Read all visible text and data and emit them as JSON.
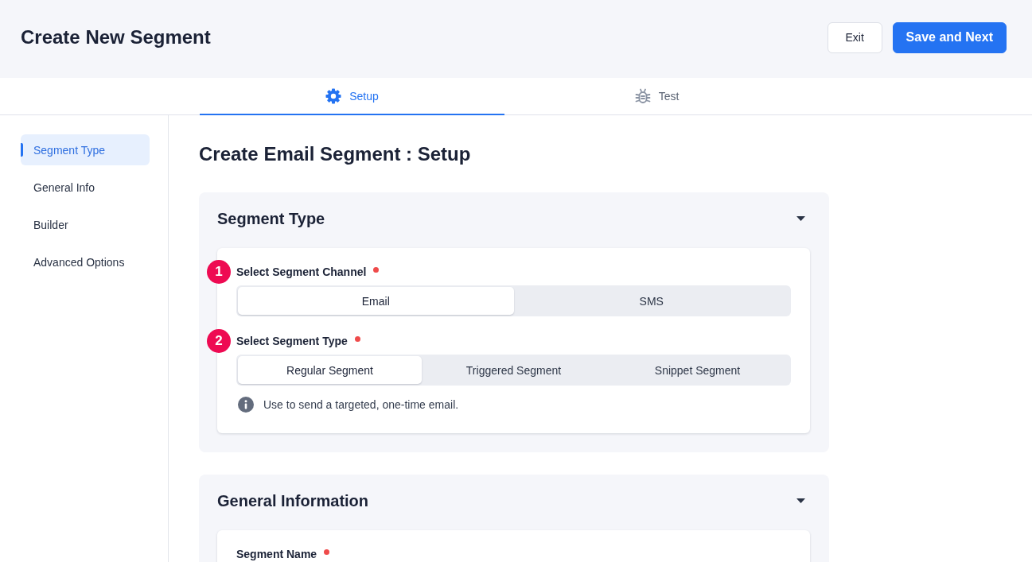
{
  "header": {
    "title": "Create New Segment",
    "buttons": [
      {
        "label": "Exit",
        "kind": "secondary"
      },
      {
        "label": "Save and Next",
        "kind": "primary"
      }
    ]
  },
  "tabs": [
    {
      "label": "Setup",
      "selected": true
    },
    {
      "label": "Test",
      "selected": false
    }
  ],
  "sidebar": {
    "items": [
      {
        "label": "Segment Type",
        "selected": true
      },
      {
        "label": "General Info",
        "selected": false
      },
      {
        "label": "Builder",
        "selected": false
      },
      {
        "label": "Advanced Options",
        "selected": false
      }
    ]
  },
  "page_title": "Create Email Segment : Setup",
  "sections": [
    {
      "title": "Segment Type",
      "expanded": true,
      "fields": [
        {
          "number": "1",
          "label": "Select Segment Channel",
          "required": true,
          "kind": "segmented",
          "options": [
            {
              "label": "Email",
              "selected": true
            },
            {
              "label": "SMS",
              "selected": false
            }
          ]
        },
        {
          "number": "2",
          "label": "Select Segment Type",
          "required": true,
          "kind": "segmented",
          "options": [
            {
              "label": "Regular Segment",
              "selected": true
            },
            {
              "label": "Triggered Segment",
              "selected": false
            },
            {
              "label": "Snippet Segment",
              "selected": false
            }
          ],
          "hint": "Use to send a targeted, one-time email."
        }
      ]
    },
    {
      "title": "General Information",
      "expanded": true,
      "fields": [
        {
          "label": "Segment Name",
          "required": true
        }
      ]
    }
  ]
}
